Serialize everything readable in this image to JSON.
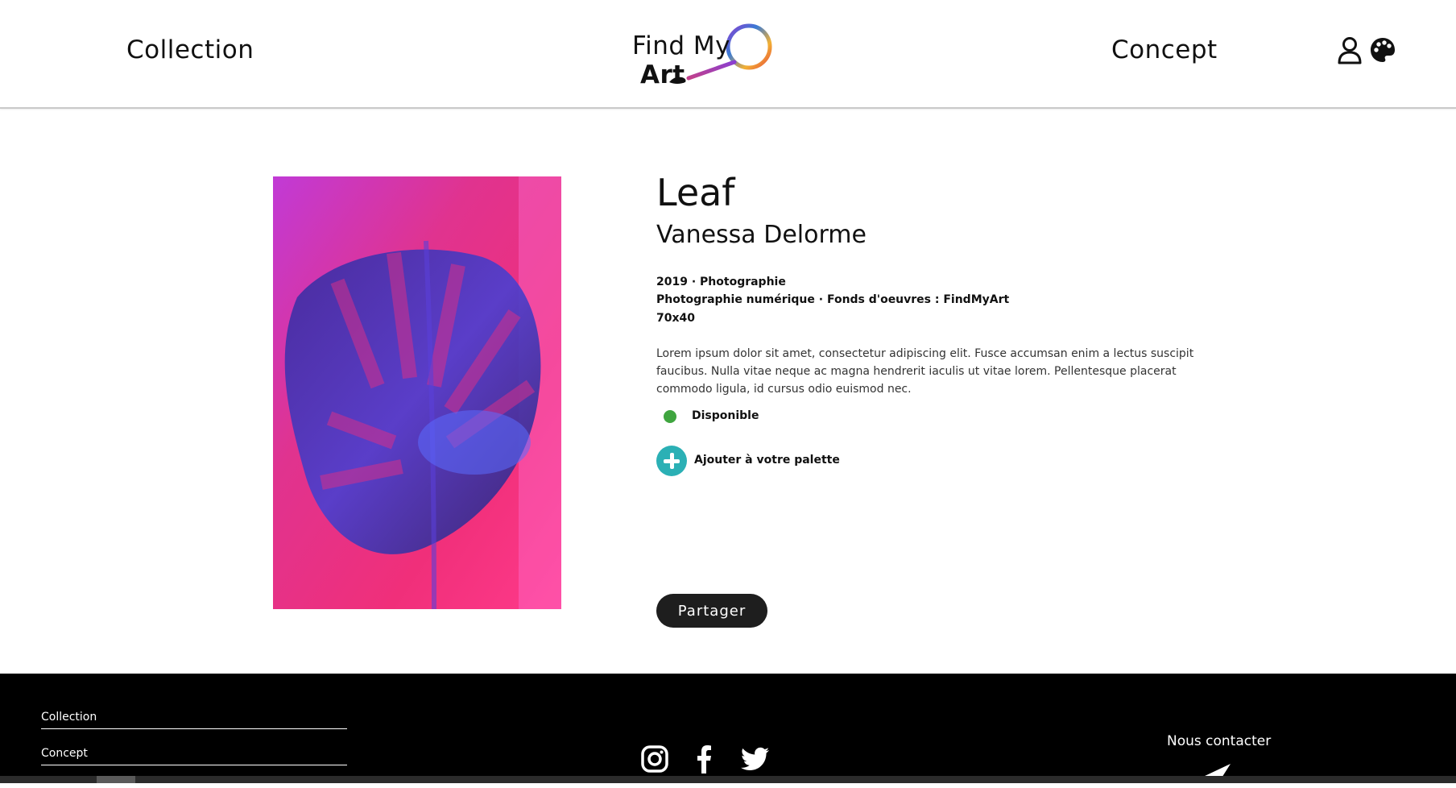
{
  "header": {
    "nav_left": "Collection",
    "nav_right": "Concept",
    "logo": {
      "text_find_my": "Find My",
      "text_art": "Art"
    },
    "icons": [
      "user-icon",
      "palette-icon"
    ]
  },
  "artwork": {
    "title": "Leaf",
    "artist": "Vanessa Delorme",
    "meta_line1": "2019 · Photographie",
    "meta_line2": "Photographie numérique · Fonds d'oeuvres : FindMyArt",
    "meta_line3": "70x40",
    "description": "Lorem ipsum dolor sit amet, consectetur adipiscing elit. Fusce accumsan enim a lectus suscipit faucibus. Nulla vitae neque ac magna hendrerit iaculis ut vitae lorem. Pellentesque placerat commodo ligula, id cursus odio euismod nec.",
    "status": "Disponible",
    "status_color": "#3fa53f",
    "add_to_palette": "Ajouter à votre palette",
    "add_color": "#2bb0b5",
    "share": "Partager"
  },
  "footer": {
    "links": [
      "Collection",
      "Concept"
    ],
    "social": [
      "instagram-icon",
      "facebook-icon",
      "twitter-icon"
    ],
    "contact": "Nous contacter"
  },
  "colors": {
    "footer_bg": "#000000",
    "button_bg": "#1e1e1e"
  }
}
